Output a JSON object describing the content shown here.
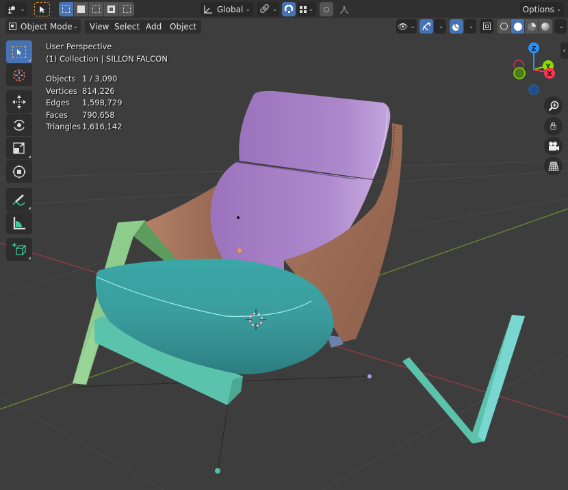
{
  "header_top": {
    "editor_type_icon": "editor-type-3d-viewport-icon",
    "transform_orientation": "Global",
    "options_label": "Options",
    "select_modes": [
      "select-new",
      "select-extend",
      "select-subtract",
      "select-difference",
      "select-intersect"
    ],
    "active_select_mode": 0
  },
  "header_menu": {
    "mode": "Object Mode",
    "menus": [
      "View",
      "Select",
      "Add",
      "Object"
    ]
  },
  "overlay_info": {
    "view_name": "User Perspective",
    "collection": "(1) Collection | SILLON FALCON",
    "stats": [
      {
        "label": "Objects",
        "value": "1 / 3,090"
      },
      {
        "label": "Vertices",
        "value": "814,226"
      },
      {
        "label": "Edges",
        "value": "1,598,729"
      },
      {
        "label": "Faces",
        "value": "790,658"
      },
      {
        "label": "Triangles",
        "value": "1,616,142"
      }
    ]
  },
  "toolbar": {
    "tools": [
      "select-box",
      "cursor",
      "move",
      "rotate",
      "scale",
      "transform",
      "annotate",
      "measure",
      "add-cube"
    ],
    "active_tool": "select-box"
  },
  "gizmo": {
    "axes": [
      "X",
      "Y",
      "Z"
    ],
    "colors": {
      "x": "#ff3352",
      "y": "#8bdc00",
      "z": "#2890ff"
    }
  },
  "nav_buttons": [
    "zoom",
    "pan",
    "camera",
    "ortho-toggle"
  ],
  "shading": {
    "modes": [
      "wireframe",
      "solid",
      "material-preview",
      "rendered"
    ],
    "active": "solid"
  },
  "colors": {
    "accent": "#4772b3",
    "background": "#3d3d3d",
    "header": "#303030",
    "seat": "#3fa3a3",
    "backrest": "#a67fc4",
    "side_panel": "#a5705a",
    "frame_light": "#8ecc8c",
    "frame_teal": "#5bc2ab"
  }
}
